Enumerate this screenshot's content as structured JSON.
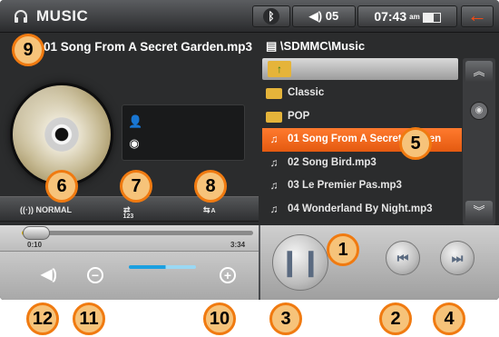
{
  "app": {
    "title": "MUSIC",
    "icon": "headphones-icon"
  },
  "status": {
    "bluetooth_icon": "bluetooth-icon",
    "volume_label": "05",
    "volume_icon": "speaker-icon",
    "time": "07:43",
    "time_suffix": "am",
    "battery_icon": "battery-icon"
  },
  "back": {
    "icon": "back-arrow-icon",
    "glyph": "←"
  },
  "now_playing": {
    "title": "01 Song From A Secret Garden.mp3"
  },
  "browser": {
    "path": "\\SDMMC\\Music",
    "items": [
      {
        "type": "folder",
        "label": "Classic"
      },
      {
        "type": "folder",
        "label": "POP"
      },
      {
        "type": "file",
        "label": "01 Song From A Secret Garden",
        "selected": true
      },
      {
        "type": "file",
        "label": "02 Song Bird.mp3"
      },
      {
        "type": "file",
        "label": "03 Le Premier Pas.mp3"
      },
      {
        "type": "file",
        "label": "04 Wonderland By Night.mp3"
      }
    ]
  },
  "modes": {
    "eq": "NORMAL",
    "order": "123",
    "repeat": "A"
  },
  "progress": {
    "elapsed": "0:10",
    "total": "3:34",
    "fraction": 0.05
  },
  "volume": {
    "level": 0.55
  },
  "colors": {
    "accent": "#f07a10",
    "selected_row": "#ff6a1a",
    "volume_bar": "#1ca0e0",
    "progress": "#e6b800"
  },
  "callouts": [
    "1",
    "2",
    "3",
    "4",
    "5",
    "6",
    "7",
    "8",
    "9",
    "10",
    "11",
    "12"
  ]
}
